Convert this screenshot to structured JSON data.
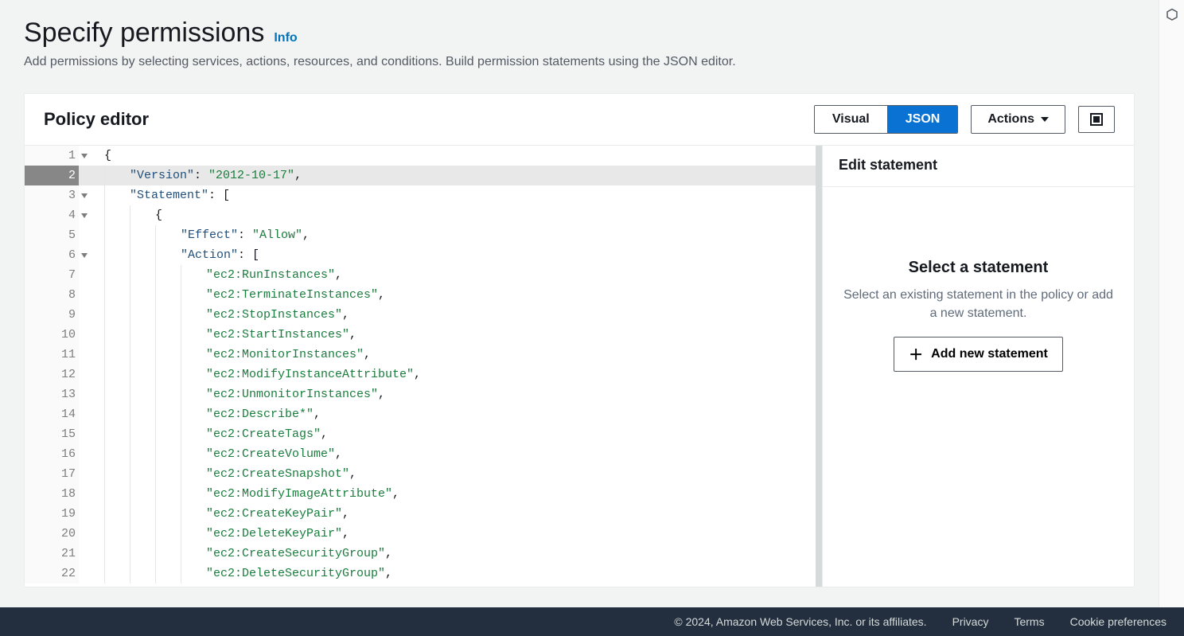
{
  "header": {
    "title": "Specify permissions",
    "info_label": "Info",
    "subtitle": "Add permissions by selecting services, actions, resources, and conditions. Build permission statements using the JSON editor."
  },
  "panel": {
    "title": "Policy editor",
    "tabs": {
      "visual": "Visual",
      "json": "JSON",
      "active": "json"
    },
    "actions_label": "Actions"
  },
  "code": {
    "active_line": 2,
    "version_key": "\"Version\"",
    "version_val": "\"2012-10-17\"",
    "statement_key": "\"Statement\"",
    "effect_key": "\"Effect\"",
    "effect_val": "\"Allow\"",
    "action_key": "\"Action\"",
    "actions": [
      "\"ec2:RunInstances\"",
      "\"ec2:TerminateInstances\"",
      "\"ec2:StopInstances\"",
      "\"ec2:StartInstances\"",
      "\"ec2:MonitorInstances\"",
      "\"ec2:ModifyInstanceAttribute\"",
      "\"ec2:UnmonitorInstances\"",
      "\"ec2:Describe*\"",
      "\"ec2:CreateTags\"",
      "\"ec2:CreateVolume\"",
      "\"ec2:CreateSnapshot\"",
      "\"ec2:ModifyImageAttribute\"",
      "\"ec2:CreateKeyPair\"",
      "\"ec2:DeleteKeyPair\"",
      "\"ec2:CreateSecurityGroup\"",
      "\"ec2:DeleteSecurityGroup\""
    ]
  },
  "side": {
    "title": "Edit statement",
    "body_title": "Select a statement",
    "body_text": "Select an existing statement in the policy or add a new statement.",
    "add_label": "Add new statement"
  },
  "footer": {
    "copyright": "© 2024, Amazon Web Services, Inc. or its affiliates.",
    "privacy": "Privacy",
    "terms": "Terms",
    "cookies": "Cookie preferences"
  }
}
